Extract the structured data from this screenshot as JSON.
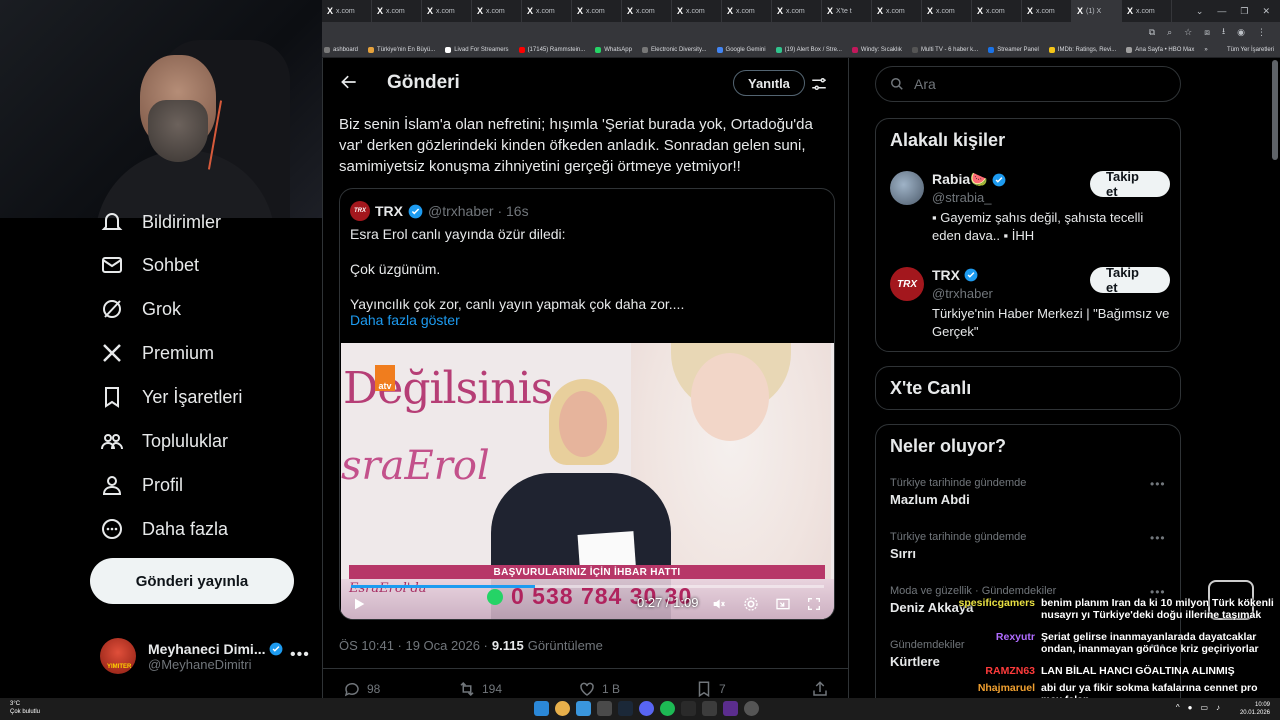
{
  "browser": {
    "tabs": [
      "x.com",
      "x.com",
      "x.com",
      "x.com",
      "x.com",
      "x.com",
      "x.com",
      "x.com",
      "x.com",
      "x.com",
      "X'te t",
      "x.com",
      "x.com",
      "x.com",
      "x.com",
      "(1) X",
      "x.com"
    ],
    "bookmarks": [
      {
        "label": "ashboard",
        "color": "#7a7a7a"
      },
      {
        "label": "Türkiye'nin En Büyü...",
        "color": "#e6a23c"
      },
      {
        "label": "Livad For Streamers",
        "color": "#ffffff"
      },
      {
        "label": "(17145) Rammstein...",
        "color": "#ff0000"
      },
      {
        "label": "WhatsApp",
        "color": "#25d366"
      },
      {
        "label": "Electronic Diversity...",
        "color": "#777777"
      },
      {
        "label": "Google Gemini",
        "color": "#4285f4"
      },
      {
        "label": "(19) Alert Box / Stre...",
        "color": "#30c48d"
      },
      {
        "label": "Windy: Sıcaklık",
        "color": "#c2185b"
      },
      {
        "label": "Multi TV - 6 haber k...",
        "color": "#555555"
      },
      {
        "label": "Streamer Panel",
        "color": "#1a73e8"
      },
      {
        "label": "IMDb: Ratings, Revi...",
        "color": "#f5c518"
      },
      {
        "label": "Ana Sayfa • HBO Max",
        "color": "#a0a0a0"
      }
    ],
    "bookmarks_more": "»",
    "all_bookmarks": "Tüm Yer İşaretleri"
  },
  "nav": {
    "items": [
      {
        "label": "Bildirimler",
        "icon": "bell-icon"
      },
      {
        "label": "Sohbet",
        "icon": "mail-icon"
      },
      {
        "label": "Grok",
        "icon": "grok-icon"
      },
      {
        "label": "Premium",
        "icon": "x-logo-icon"
      },
      {
        "label": "Yer İşaretleri",
        "icon": "bookmark-icon"
      },
      {
        "label": "Topluluklar",
        "icon": "communities-icon"
      },
      {
        "label": "Profil",
        "icon": "person-icon"
      },
      {
        "label": "Daha fazla",
        "icon": "more-circle-icon"
      }
    ],
    "post_button": "Gönderi yayınla",
    "profile": {
      "name": "Meyhaneci Dimi...",
      "handle": "@MeyhaneDimitri",
      "avatar_text": "YIMITER"
    }
  },
  "post": {
    "header_title": "Gönderi",
    "reply_button": "Yanıtla",
    "text": "Biz senin İslam'a olan nefretini; hışımla 'Şeriat burada yok, Ortadoğu'da var' derken gözlerindeki kinden öfkeden anladık. Sonradan gelen suni, samimiyetsiz konuşma zihniyetini gerçeği örtmeye yetmiyor!!",
    "quote": {
      "logo": "TRX",
      "name": "TRX",
      "handle": "@trxhaber · 16s",
      "lines": [
        "Esra Erol canlı yayında özür diledi:",
        "Çok üzgünüm.",
        "Yayıncılık çok zor, canlı yayın yapmak çok daha zor...."
      ],
      "show_more": "Daha fazla göster",
      "video": {
        "bg_text_1": "Değilsinis",
        "bg_text_2": "sraErol",
        "channel_logo": "atv",
        "band": "BAŞVURULARINIZ İÇİN İHBAR HATTI",
        "show_name": "EsraErol'da",
        "phone": "0 538 784 30 30",
        "time": "0:27 / 1:09",
        "progress": 0.39
      }
    },
    "meta_time": "ÖS 10:41 · 19 Oca 2026 ·",
    "meta_views": "9.115",
    "meta_views_label": "Görüntüleme",
    "actions": {
      "replies": "98",
      "reposts": "194",
      "likes": "1 B",
      "bookmarks": "7"
    }
  },
  "sidebar": {
    "search_placeholder": "Ara",
    "related_title": "Alakalı kişiler",
    "related": [
      {
        "name": "Rabia🍉",
        "handle": "@strabia_",
        "bio": "▪ Gayemiz şahıs değil, şahısta tecelli eden dava.. ▪ İHH",
        "follow": "Takip et",
        "avatar_color": "#8aa0b8"
      },
      {
        "name": "TRX",
        "handle": "@trxhaber",
        "bio": "Türkiye'nin Haber Merkezi | \"Bağımsız ve Gerçek\"",
        "follow": "Takip et",
        "avatar_color": "#a3171d"
      }
    ],
    "live_title": "X'te Canlı",
    "trends_title": "Neler oluyor?",
    "trends": [
      {
        "category": "Türkiye tarihinde gündemde",
        "name": "Mazlum Abdi"
      },
      {
        "category": "Türkiye tarihinde gündemde",
        "name": "Sırrı"
      },
      {
        "category": "Moda ve güzellik · Gündemdekiler",
        "name": "Deniz Akkaya"
      },
      {
        "category": "Gündemdekiler",
        "name": "Kürtlere"
      }
    ]
  },
  "chat": [
    {
      "user": "spesificgamers",
      "color": "#e8e042",
      "msg": "benim planım Iran da ki 10 milyon Türk kökenli nusayrı yı Türkiye'deki doğu illerine taşımak"
    },
    {
      "user": "Rexyutr",
      "color": "#b06cff",
      "msg": "Şeriat gelirse inanmayanlarada dayatcaklar ondan, inanmayan görünce kriz geçiriyorlar"
    },
    {
      "user": "RAMZN63",
      "color": "#ff3b3b",
      "msg": "LAN BİLAL HANCI GÖALTINA ALINMIŞ"
    },
    {
      "user": "Nhajmaruel",
      "color": "#f0a030",
      "msg": "abi dur ya fikir sokma kafalarına cennet pro max falan"
    }
  ],
  "taskbar": {
    "weather_temp": "3°C",
    "weather_desc": "Çok bulutlu",
    "time": "10:09",
    "date": "20.01.2026"
  }
}
